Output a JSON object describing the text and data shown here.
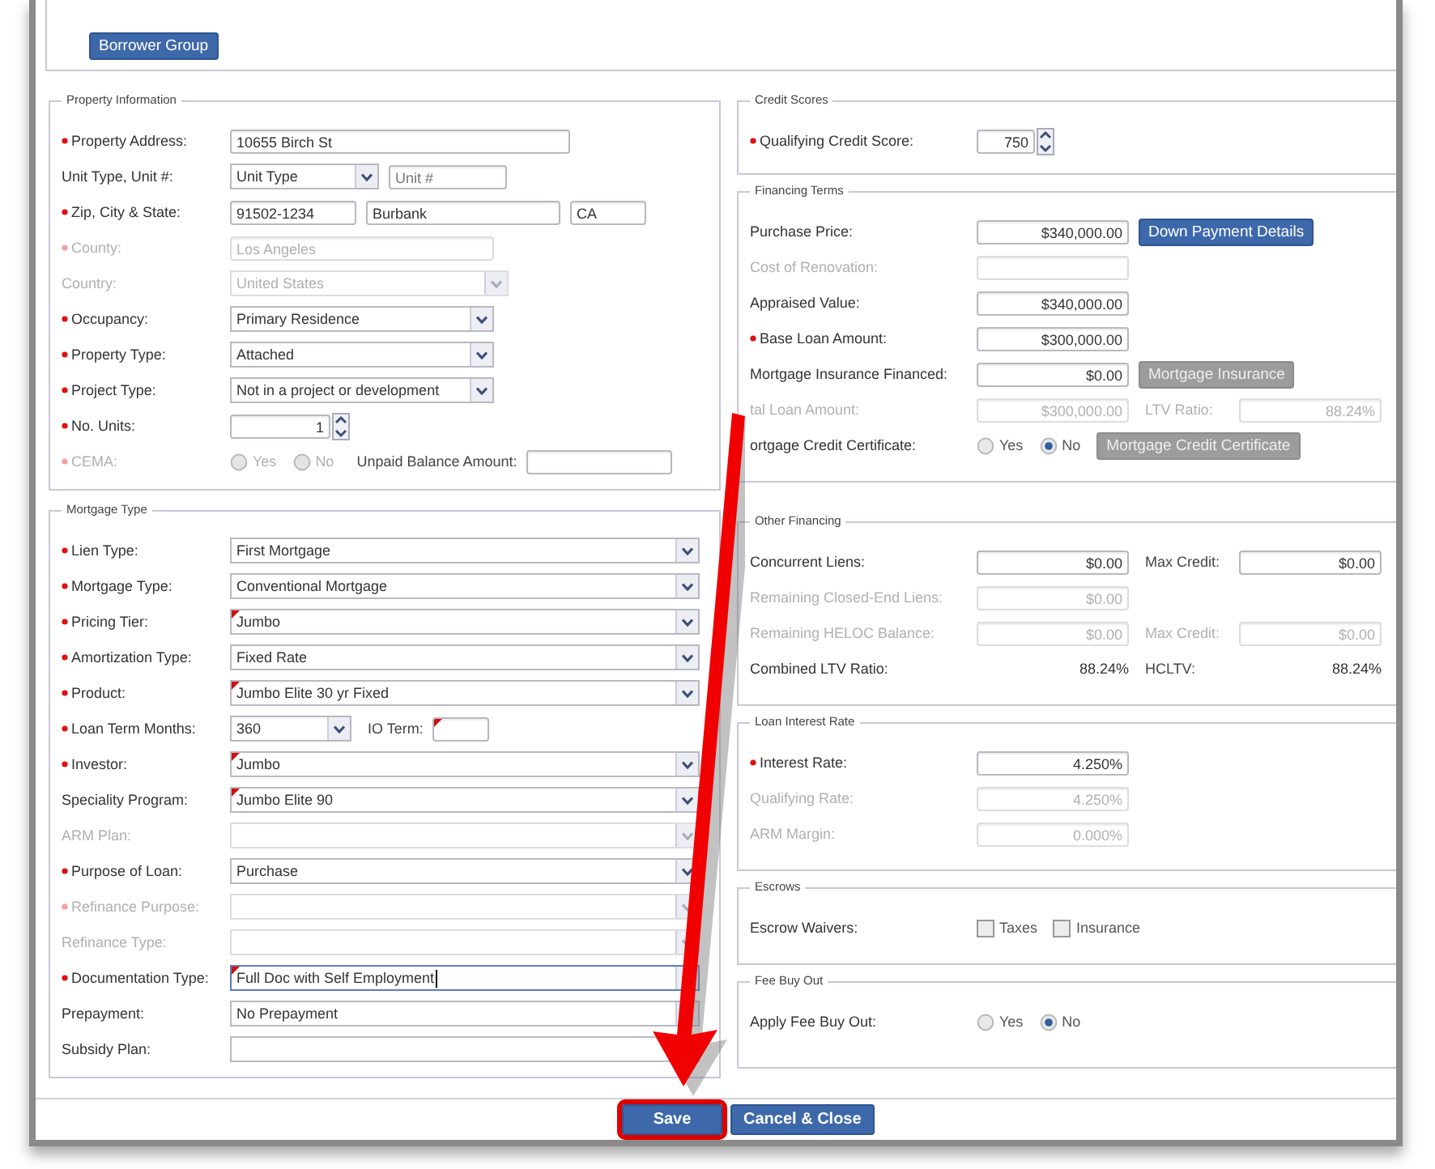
{
  "top": {
    "button": "Borrower Group"
  },
  "left": [
    {
      "title": "Property Information",
      "rows": [
        {
          "label": "Property Address:",
          "required": true,
          "disabled": false,
          "controls": [
            {
              "kind": "text",
              "value": "10655 Birch St"
            }
          ]
        },
        {
          "label": "Unit Type, Unit #:",
          "required": false,
          "disabled": false,
          "controls": [
            {
              "kind": "select",
              "value": "Unit Type"
            },
            {
              "kind": "text",
              "placeholder": "Unit #"
            }
          ]
        },
        {
          "label": "Zip, City & State:",
          "required": true,
          "disabled": false,
          "controls": [
            {
              "kind": "text",
              "value": "91502-1234"
            },
            {
              "kind": "text",
              "value": "Burbank"
            },
            {
              "kind": "text",
              "value": "CA"
            }
          ]
        },
        {
          "label": "County:",
          "required": true,
          "disabled": true,
          "controls": [
            {
              "kind": "text",
              "value": "Los Angeles"
            }
          ]
        },
        {
          "label": "Country:",
          "required": false,
          "disabled": true,
          "controls": [
            {
              "kind": "select",
              "value": "United States"
            }
          ]
        },
        {
          "label": "Occupancy:",
          "required": true,
          "disabled": false,
          "controls": [
            {
              "kind": "select",
              "value": "Primary Residence"
            }
          ]
        },
        {
          "label": "Property Type:",
          "required": true,
          "disabled": false,
          "controls": [
            {
              "kind": "select",
              "value": "Attached"
            }
          ]
        },
        {
          "label": "Project Type:",
          "required": true,
          "disabled": false,
          "controls": [
            {
              "kind": "select",
              "value": "Not in a project or development"
            }
          ]
        },
        {
          "label": "No. Units:",
          "required": true,
          "disabled": false,
          "controls": [
            {
              "kind": "spinner",
              "value": "1"
            }
          ]
        },
        {
          "label": "CEMA:",
          "required": true,
          "disabled": true,
          "controls": [
            {
              "kind": "radio",
              "label": "Yes",
              "selected": false
            },
            {
              "kind": "radio",
              "label": "No",
              "selected": false
            },
            {
              "kind": "label",
              "text": "Unpaid Balance Amount:",
              "disabled": false
            },
            {
              "kind": "text",
              "disabled": false
            }
          ]
        }
      ]
    },
    {
      "title": "Mortgage Type",
      "rows": [
        {
          "label": "Lien Type:",
          "required": true,
          "disabled": false,
          "controls": [
            {
              "kind": "select",
              "value": "First Mortgage"
            }
          ]
        },
        {
          "label": "Mortgage Type:",
          "required": true,
          "disabled": false,
          "controls": [
            {
              "kind": "select",
              "value": "Conventional Mortgage"
            }
          ]
        },
        {
          "label": "Pricing Tier:",
          "required": true,
          "disabled": false,
          "controls": [
            {
              "kind": "select",
              "value": "Jumbo",
              "flagged": true
            }
          ]
        },
        {
          "label": "Amortization Type:",
          "required": true,
          "disabled": false,
          "controls": [
            {
              "kind": "select",
              "value": "Fixed Rate"
            }
          ]
        },
        {
          "label": "Product:",
          "required": true,
          "disabled": false,
          "controls": [
            {
              "kind": "select",
              "value": "Jumbo Elite 30 yr Fixed",
              "flagged": true
            }
          ]
        },
        {
          "label": "Loan Term Months:",
          "required": true,
          "disabled": false,
          "controls": [
            {
              "kind": "select",
              "value": "360"
            },
            {
              "kind": "label",
              "text": "IO Term:"
            },
            {
              "kind": "text",
              "flagged": true
            }
          ]
        },
        {
          "label": "Investor:",
          "required": true,
          "disabled": false,
          "controls": [
            {
              "kind": "select",
              "value": "Jumbo",
              "flagged": true
            }
          ]
        },
        {
          "label": "Speciality Program:",
          "required": false,
          "disabled": false,
          "controls": [
            {
              "kind": "select",
              "value": "Jumbo Elite 90",
              "flagged": true
            }
          ]
        },
        {
          "label": "ARM Plan:",
          "required": false,
          "disabled": true,
          "controls": [
            {
              "kind": "select"
            }
          ]
        },
        {
          "label": "Purpose of Loan:",
          "required": true,
          "disabled": false,
          "controls": [
            {
              "kind": "select",
              "value": "Purchase"
            }
          ]
        },
        {
          "label": "Refinance Purpose:",
          "required": true,
          "disabled": true,
          "controls": [
            {
              "kind": "select"
            }
          ]
        },
        {
          "label": "Refinance Type:",
          "required": false,
          "disabled": true,
          "controls": [
            {
              "kind": "select"
            }
          ]
        },
        {
          "label": "Documentation Type:",
          "required": true,
          "disabled": false,
          "controls": [
            {
              "kind": "select",
              "value": "Full Doc with Self Employment",
              "flagged": true,
              "focused": true
            }
          ]
        },
        {
          "label": "Prepayment:",
          "required": false,
          "disabled": false,
          "controls": [
            {
              "kind": "select",
              "value": "No Prepayment"
            }
          ]
        },
        {
          "label": "Subsidy Plan:",
          "required": false,
          "disabled": false,
          "controls": [
            {
              "kind": "select"
            }
          ]
        }
      ]
    }
  ],
  "right": [
    {
      "title": "Credit Scores",
      "rows": [
        {
          "label": "Qualifying Credit Score:",
          "required": true,
          "disabled": false,
          "controls": [
            {
              "kind": "spinner",
              "value": "750"
            }
          ]
        }
      ]
    },
    {
      "title": "Financing Terms",
      "rows": [
        {
          "label": "Purchase Price:",
          "required": false,
          "disabled": false,
          "controls": [
            {
              "kind": "text",
              "value": "$340,000.00"
            },
            {
              "kind": "button",
              "label": "Down Payment Details",
              "disabled": false
            }
          ]
        },
        {
          "label": "Cost of Renovation:",
          "required": false,
          "disabled": true,
          "controls": [
            {
              "kind": "text"
            }
          ]
        },
        {
          "label": "Appraised Value:",
          "required": false,
          "disabled": false,
          "controls": [
            {
              "kind": "text",
              "value": "$340,000.00"
            }
          ]
        },
        {
          "label": "Base Loan Amount:",
          "required": true,
          "disabled": false,
          "controls": [
            {
              "kind": "text",
              "value": "$300,000.00"
            }
          ]
        },
        {
          "label": "Mortgage Insurance Financed:",
          "required": false,
          "disabled": false,
          "controls": [
            {
              "kind": "text",
              "value": "$0.00"
            },
            {
              "kind": "button",
              "label": "Mortgage Insurance",
              "disabled": true
            }
          ]
        },
        {
          "label": "tal Loan Amount:",
          "required": false,
          "disabled": true,
          "controls": [
            {
              "kind": "text",
              "value": "$300,000.00"
            },
            {
              "kind": "label",
              "text": "LTV Ratio:"
            },
            {
              "kind": "text",
              "value": "88.24%"
            }
          ]
        },
        {
          "label": "ortgage Credit Certificate:",
          "required": false,
          "disabled": false,
          "controls": [
            {
              "kind": "radio",
              "label": "Yes",
              "selected": false
            },
            {
              "kind": "radio",
              "label": "No",
              "selected": true
            },
            {
              "kind": "button",
              "label": "Mortgage Credit Certificate",
              "disabled": true
            }
          ]
        }
      ]
    },
    {
      "title": "Other Financing",
      "rows": [
        {
          "label": "Concurrent Liens:",
          "required": false,
          "disabled": false,
          "controls": [
            {
              "kind": "text",
              "value": "$0.00"
            },
            {
              "kind": "label",
              "text": "Max Credit:"
            },
            {
              "kind": "text",
              "value": "$0.00"
            }
          ]
        },
        {
          "label": "Remaining Closed-End Liens:",
          "required": false,
          "disabled": true,
          "controls": [
            {
              "kind": "text",
              "value": "$0.00"
            }
          ]
        },
        {
          "label": "Remaining HELOC Balance:",
          "required": false,
          "disabled": true,
          "controls": [
            {
              "kind": "text",
              "value": "$0.00"
            },
            {
              "kind": "label",
              "text": "Max Credit:"
            },
            {
              "kind": "text",
              "value": "$0.00"
            }
          ]
        },
        {
          "label": "Combined LTV Ratio:",
          "required": false,
          "disabled": false,
          "controls": [
            {
              "kind": "readout",
              "value": "88.24%"
            },
            {
              "kind": "label",
              "text": "HCLTV:"
            },
            {
              "kind": "readout",
              "value": "88.24%"
            }
          ]
        }
      ]
    },
    {
      "title": "Loan Interest Rate",
      "rows": [
        {
          "label": "Interest Rate:",
          "required": true,
          "disabled": false,
          "controls": [
            {
              "kind": "text",
              "value": "4.250%"
            }
          ]
        },
        {
          "label": "Qualifying Rate:",
          "required": false,
          "disabled": true,
          "controls": [
            {
              "kind": "text",
              "value": "4.250%"
            }
          ]
        },
        {
          "label": "ARM Margin:",
          "required": false,
          "disabled": true,
          "controls": [
            {
              "kind": "text",
              "value": "0.000%"
            }
          ]
        }
      ]
    },
    {
      "title": "Escrows",
      "rows": [
        {
          "label": "Escrow Waivers:",
          "required": false,
          "disabled": false,
          "controls": [
            {
              "kind": "checkbox",
              "label": "Taxes",
              "checked": false
            },
            {
              "kind": "checkbox",
              "label": "Insurance",
              "checked": false
            }
          ]
        }
      ]
    },
    {
      "title": "Fee Buy Out",
      "rows": [
        {
          "label": "Apply Fee Buy Out:",
          "required": false,
          "disabled": false,
          "controls": [
            {
              "kind": "radio",
              "label": "Yes",
              "selected": false
            },
            {
              "kind": "radio",
              "label": "No",
              "selected": true
            }
          ]
        }
      ]
    }
  ],
  "footer": {
    "buttons": [
      {
        "label": "Save",
        "highlighted": true
      },
      {
        "label": "Cancel & Close",
        "highlighted": false
      }
    ]
  }
}
